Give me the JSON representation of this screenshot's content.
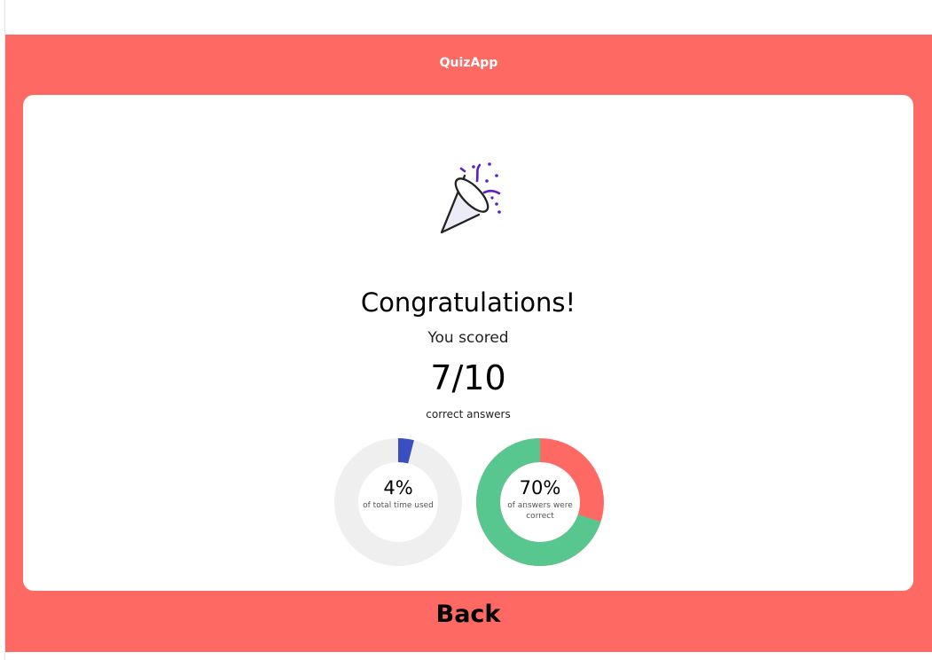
{
  "header": {
    "title": "QuizApp"
  },
  "result": {
    "icon": "party-popper-icon",
    "heading": "Congratulations!",
    "subheading": "You scored",
    "score": "7/10",
    "score_caption": "correct answers"
  },
  "stats": {
    "time": {
      "value": "4%",
      "fraction": 0.04,
      "label": "of total time used"
    },
    "correct": {
      "value": "70%",
      "fraction": 0.7,
      "label": "of answers were correct"
    }
  },
  "actions": {
    "back_label": "Back"
  },
  "colors": {
    "brand": "#ff6964",
    "card": "#ffffff",
    "time_fill": "#3a4fc0",
    "time_track": "#efefef",
    "correct_fill": "#57c78f",
    "incorrect_fill": "#ff6964",
    "icon_accent": "#5b1fc7"
  }
}
